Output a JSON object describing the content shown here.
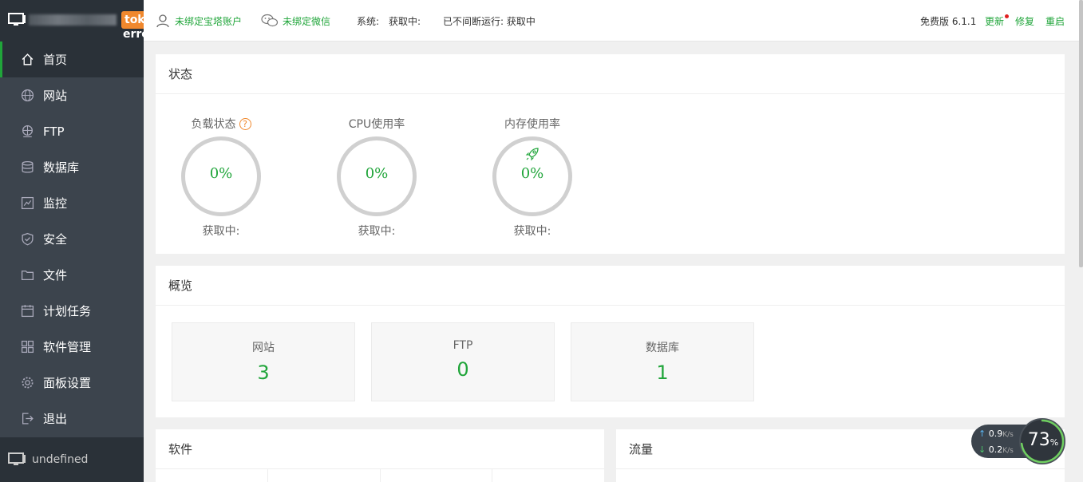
{
  "sidebar": {
    "brand_tag": "toke",
    "brand_err": "erro",
    "items": [
      {
        "label": "首页",
        "icon": "home-icon"
      },
      {
        "label": "网站",
        "icon": "globe-icon"
      },
      {
        "label": "FTP",
        "icon": "ftp-icon"
      },
      {
        "label": "数据库",
        "icon": "database-icon"
      },
      {
        "label": "监控",
        "icon": "monitor-chart-icon"
      },
      {
        "label": "安全",
        "icon": "shield-icon"
      },
      {
        "label": "文件",
        "icon": "folder-icon"
      },
      {
        "label": "计划任务",
        "icon": "calendar-icon"
      },
      {
        "label": "软件管理",
        "icon": "grid-icon"
      },
      {
        "label": "面板设置",
        "icon": "gear-icon"
      },
      {
        "label": "退出",
        "icon": "logout-icon"
      }
    ],
    "footer_label": "undefined"
  },
  "header": {
    "bind_bt_account": "未绑定宝塔账户",
    "bind_wechat": "未绑定微信",
    "system_label": "系统:",
    "system_value": "获取中:",
    "uptime": "已不间断运行: 获取中",
    "version": "免费版 6.1.1",
    "update": "更新",
    "repair": "修复",
    "restart": "重启"
  },
  "status": {
    "title": "状态",
    "gauges": [
      {
        "label": "负载状态",
        "value": "0%",
        "sub": "获取中:"
      },
      {
        "label": "CPU使用率",
        "value": "0%",
        "sub": "获取中:"
      },
      {
        "label": "内存使用率",
        "value": "0%",
        "sub": "获取中:"
      }
    ]
  },
  "overview": {
    "title": "概览",
    "cards": [
      {
        "label": "网站",
        "value": "3"
      },
      {
        "label": "FTP",
        "value": "0"
      },
      {
        "label": "数据库",
        "value": "1"
      }
    ]
  },
  "software": {
    "title": "软件"
  },
  "traffic": {
    "title": "流量"
  },
  "speed": {
    "up": "0.9",
    "down": "0.2",
    "unit": "K/s",
    "percent": "73",
    "percent_sign": "%"
  },
  "colors": {
    "accent": "#20a53a",
    "sidebar": "#3c444d",
    "warn": "#f0882d"
  }
}
